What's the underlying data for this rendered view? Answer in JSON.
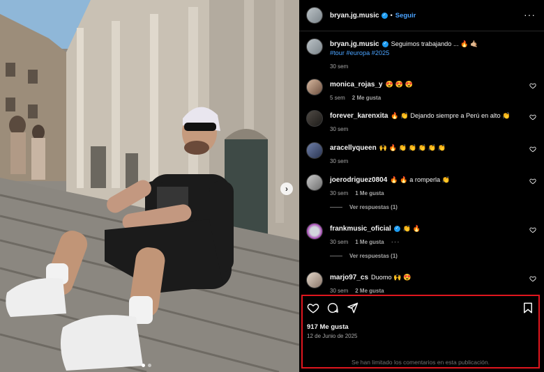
{
  "post": {
    "username": "bryan.jg.music",
    "follow_label": "Seguir",
    "separator": "•",
    "more_label": "···",
    "caption_text": "Seguimos trabajando ... 🔥 🤙🏼",
    "caption_tags": "#tour #europa #2025",
    "caption_time": "30 sem",
    "likes": "917 Me gusta",
    "date": "12 de Junio de 2025",
    "comments_limited": "Se han limitado los comentarios en esta publicación."
  },
  "comments": [
    {
      "username": "monica_rojas_y",
      "text": "😍 😍 😍",
      "time": "5 sem",
      "likes": "2 Me gusta"
    },
    {
      "username": "forever_karenxita",
      "text": "🔥 👏 Dejando siempre a Perú en alto 👏",
      "time": "30 sem",
      "likes": ""
    },
    {
      "username": "aracellyqueen",
      "text": "🙌 🔥 👏 👏 👏 👏 👏",
      "time": "30 sem",
      "likes": ""
    },
    {
      "username": "joerodriguez0804",
      "text": "🔥 🔥 a romperla 👏",
      "time": "30 sem",
      "likes": "1 Me gusta",
      "replies": "Ver respuestas (1)"
    },
    {
      "username": "frankmusic_oficial",
      "text": "👏 🔥",
      "time": "30 sem",
      "likes": "1 Me gusta",
      "more": "···",
      "replies": "Ver respuestas (1)"
    },
    {
      "username": "marjo97_cs",
      "text": "Duomo 🙌 😍",
      "time": "30 sem",
      "likes": "2 Me gusta"
    }
  ],
  "icons": {
    "like": "heart-icon",
    "comment": "comment-icon",
    "share": "send-icon",
    "save": "bookmark-icon",
    "verified": "verified-badge-icon",
    "carousel": "chevron-right-icon"
  },
  "colors": {
    "link": "#4aa3ff",
    "highlight": "#e0161e",
    "verified": "#1d9bf0"
  }
}
